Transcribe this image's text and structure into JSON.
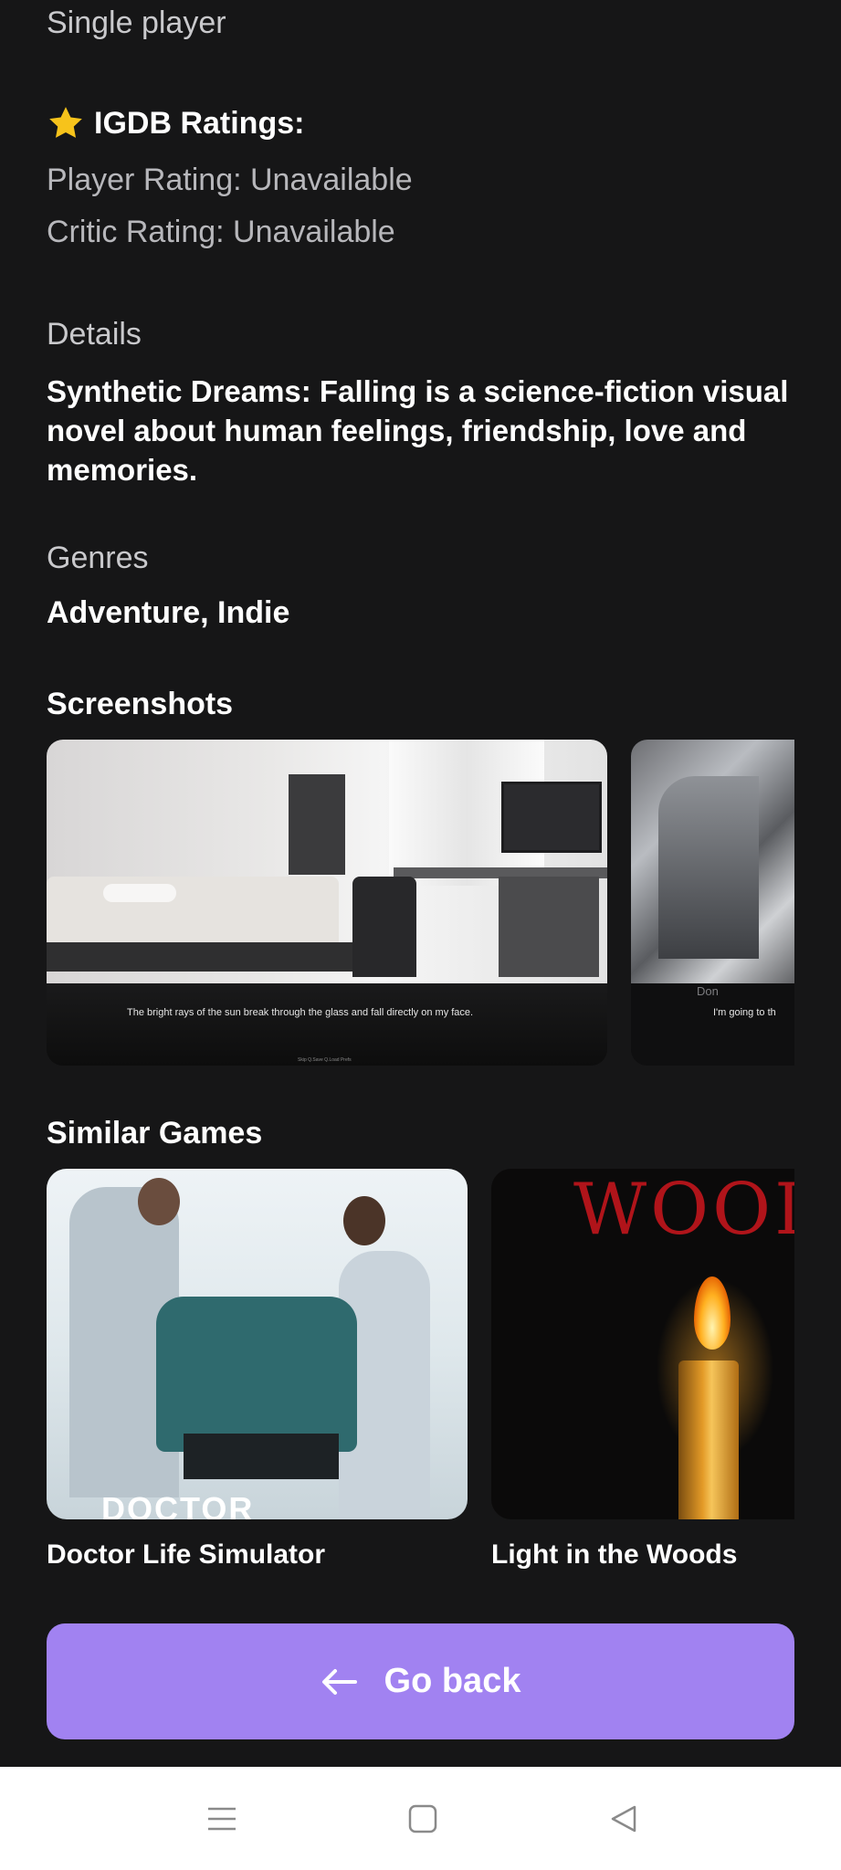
{
  "mode": "Single player",
  "ratings": {
    "title": "IGDB Ratings:",
    "player": "Player Rating: Unavailable",
    "critic": "Critic Rating: Unavailable"
  },
  "details": {
    "label": "Details",
    "text": "Synthetic Dreams: Falling is a science-fiction visual novel about human feelings, friendship, love and memories."
  },
  "genres": {
    "label": "Genres",
    "value": "Adventure, Indie"
  },
  "screenshots": {
    "heading": "Screenshots",
    "items": [
      {
        "dialog": "The bright rays of the sun break through the glass and fall directly on my face.",
        "menu": "Skip   Q.Save   Q.Load   Prefs"
      },
      {
        "speaker": "Don",
        "dialog": "I'm going to th"
      }
    ]
  },
  "similar": {
    "heading": "Similar Games",
    "items": [
      {
        "title": "Doctor Life Simulator",
        "logo_text": "DOCTOR"
      },
      {
        "title": "Light in the Woods",
        "logo_text": "WOODS"
      }
    ]
  },
  "go_back": {
    "label": "Go back",
    "icon": "arrow-left-icon"
  },
  "navbar": {
    "items": [
      "menu-icon",
      "home-icon",
      "back-icon"
    ]
  },
  "colors": {
    "background": "#161617",
    "accent": "#a182f1",
    "star": "#f7c31b"
  }
}
